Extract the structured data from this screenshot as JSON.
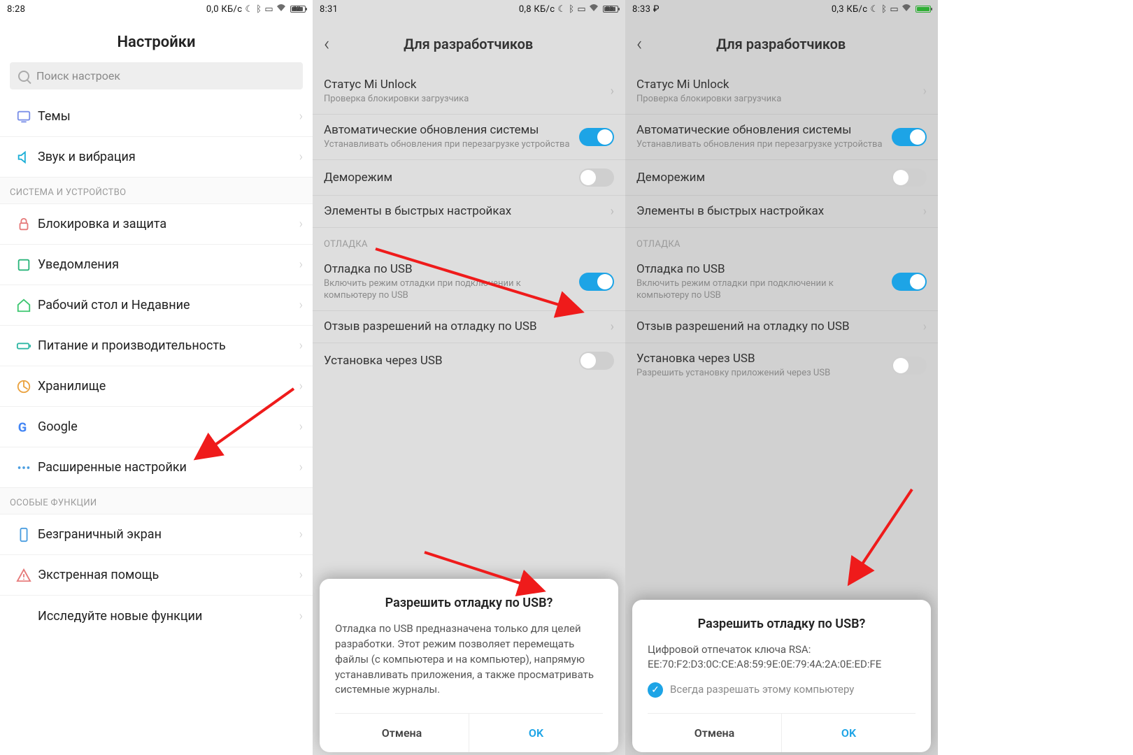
{
  "panel1": {
    "time": "8:28",
    "net": "0,0 КБ/с",
    "batt_pct": "82",
    "title": "Настройки",
    "search_placeholder": "Поиск настроек",
    "rows": {
      "themes": "Темы",
      "sound": "Звук и вибрация"
    },
    "section1": "СИСТЕМА И УСТРОЙСТВО",
    "rows2": {
      "lock": "Блокировка и защита",
      "notif": "Уведомления",
      "home": "Рабочий стол и Недавние",
      "power": "Питание и производительность",
      "storage": "Хранилище",
      "google": "Google",
      "advanced": "Расширенные настройки"
    },
    "section2": "ОСОБЫЕ ФУНКЦИИ",
    "rows3": {
      "fullscreen": "Безграничный экран",
      "emergency": "Экстренная помощь",
      "explore": "Исследуйте новые функции"
    }
  },
  "panel2": {
    "time": "8:31",
    "net": "0,8 КБ/с",
    "batt_pct": "83",
    "title": "Для разработчиков",
    "mi_unlock": "Статус Mi Unlock",
    "mi_unlock_sub": "Проверка блокировки загрузчика",
    "auto_update": "Автоматические обновления системы",
    "auto_update_sub": "Устанавливать обновления при перезагрузке устройства",
    "demo": "Деморежим",
    "qs": "Элементы в быстрых настройках",
    "debug_section": "ОТЛАДКА",
    "usb_debug": "Отладка по USB",
    "usb_debug_sub": "Включить режим отладки при подключении к компьютеру по USB",
    "revoke": "Отзыв разрешений на отладку по USB",
    "install_usb": "Установка через USB",
    "dialog": {
      "title": "Разрешить отладку по USB?",
      "body": "Отладка по USB предназначена только для целей разработки. Этот режим позволяет перемещать файлы (с компьютера и на компьютер), напрямую устанавливать приложения, а также просматривать системные журналы.",
      "cancel": "Отмена",
      "ok": "OK"
    }
  },
  "panel3": {
    "time": "8:33",
    "currency": "₽",
    "net": "0,3 КБ/с",
    "title": "Для разработчиков",
    "mi_unlock": "Статус Mi Unlock",
    "mi_unlock_sub": "Проверка блокировки загрузчика",
    "auto_update": "Автоматические обновления системы",
    "auto_update_sub": "Устанавливать обновления при перезагрузке устройства",
    "demo": "Деморежим",
    "qs": "Элементы в быстрых настройках",
    "debug_section": "ОТЛАДКА",
    "usb_debug": "Отладка по USB",
    "usb_debug_sub": "Включить режим отладки при подключении к компьютеру по USB",
    "revoke": "Отзыв разрешений на отладку по USB",
    "install_usb": "Установка через USB",
    "install_usb_sub": "Разрешить установку приложений через USB",
    "dialog": {
      "title": "Разрешить отладку по USB?",
      "body_line1": "Цифровой отпечаток ключа RSA:",
      "body_line2": "EE:70:F2:D3:0C:CE:A8:59:9E:0E:79:4A:2A:0E:ED:FE",
      "checkbox": "Всегда разрешать этому компьютеру",
      "cancel": "Отмена",
      "ok": "OK"
    }
  }
}
